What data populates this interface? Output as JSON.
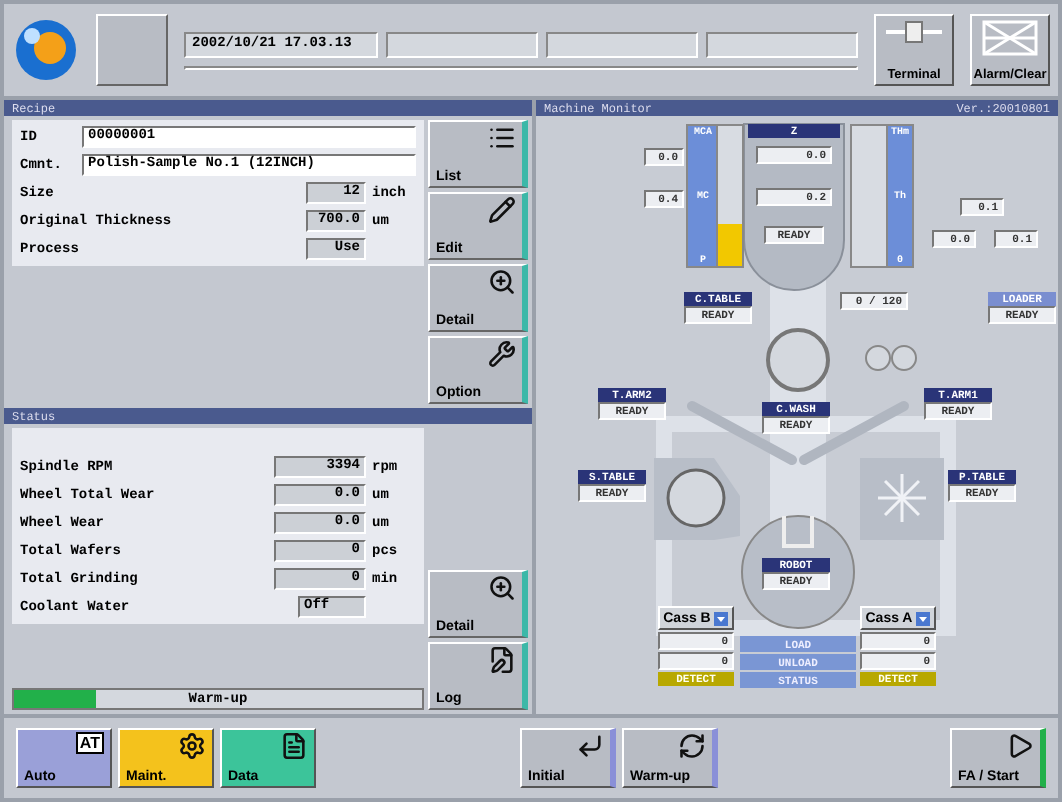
{
  "top_bar": {
    "clock": "2002/10/21 17.03.13",
    "buttons": [
      {
        "label": "Terminal",
        "kind": "terminal"
      },
      {
        "label": "Alarm/Clear",
        "kind": "alarm"
      }
    ]
  },
  "recipe": {
    "title": "Recipe",
    "fields": [
      {
        "label": "ID",
        "value": "00000001",
        "kind": "wide"
      },
      {
        "label": "Cmnt.",
        "value": "Polish-Sample No.1 (12INCH)",
        "kind": "wide"
      },
      {
        "label": "Size",
        "value": "12",
        "unit": "inch",
        "kind": "short"
      },
      {
        "label": "Original Thickness",
        "value": "700.0",
        "unit": "um",
        "kind": "short"
      },
      {
        "label": "Process",
        "value": "Use",
        "kind": "short"
      }
    ],
    "buttons": [
      {
        "label": "List",
        "kind": "list"
      },
      {
        "label": "Edit",
        "kind": "edit"
      },
      {
        "label": "Detail",
        "kind": "detail"
      },
      {
        "label": "Option",
        "kind": "option"
      }
    ]
  },
  "status": {
    "title": "Status",
    "rows": [
      {
        "label": "Spindle RPM",
        "value": "3394",
        "unit": "rpm"
      },
      {
        "label": "Wheel Total Wear",
        "value": "0.0",
        "unit": "um"
      },
      {
        "label": "Wheel Wear",
        "value": "0.0",
        "unit": "um"
      },
      {
        "label": "Total Wafers",
        "value": "0",
        "unit": "pcs"
      },
      {
        "label": "Total Grinding",
        "value": "0",
        "unit": "min"
      },
      {
        "label": "Coolant Water",
        "value": "Off"
      }
    ],
    "progress": {
      "label": "Warm-up",
      "level": 0.2
    },
    "buttons": [
      {
        "label": "Detail",
        "kind": "detail"
      },
      {
        "label": "Log",
        "kind": "log"
      }
    ]
  },
  "monitor": {
    "title": "Machine Monitor",
    "version": "Ver.:20010801",
    "left_meter": {
      "labels": [
        "MCA",
        "MC",
        "P"
      ],
      "level": 0.3
    },
    "right_meter": {
      "labels": [
        "THm",
        "Th",
        "0"
      ]
    },
    "left_readings": [
      "0.0",
      "0.4"
    ],
    "z": {
      "label": "Z",
      "values": [
        "0.0",
        "0.2"
      ],
      "status": "READY"
    },
    "right_readings": [
      "0.1",
      "0.0",
      "0.1"
    ],
    "counter": "0 / 120",
    "units": [
      {
        "label": "C.TABLE",
        "status": "READY",
        "active": true
      },
      {
        "label": "LOADER",
        "status": "READY",
        "active": false
      },
      {
        "label": "T.ARM2",
        "status": "READY",
        "active": true
      },
      {
        "label": "C.WASH",
        "status": "READY",
        "active": true
      },
      {
        "label": "T.ARM1",
        "status": "READY",
        "active": true
      },
      {
        "label": "S.TABLE",
        "status": "READY",
        "active": true
      },
      {
        "label": "P.TABLE",
        "status": "READY",
        "active": true
      },
      {
        "label": "ROBOT",
        "status": "READY",
        "active": true
      }
    ],
    "cassettes": [
      {
        "label": "Cass B",
        "counts": [
          "0",
          "0"
        ],
        "detect": "DETECT"
      },
      {
        "label": "Cass A",
        "counts": [
          "0",
          "0"
        ],
        "detect": "DETECT"
      }
    ],
    "commands": [
      "LOAD",
      "UNLOAD",
      "STATUS"
    ]
  },
  "bottom_bar": {
    "modes": [
      {
        "label": "Auto",
        "kind": "auto",
        "badge": "AT",
        "color": "#9aa0d8"
      },
      {
        "label": "Maint.",
        "kind": "maint",
        "color": "#f4c21c"
      },
      {
        "label": "Data",
        "kind": "data",
        "color": "#3cc49a"
      }
    ],
    "actions": [
      {
        "label": "Initial",
        "kind": "initial"
      },
      {
        "label": "Warm-up",
        "kind": "warmup"
      },
      {
        "label": "FA / Start",
        "kind": "start"
      }
    ]
  }
}
